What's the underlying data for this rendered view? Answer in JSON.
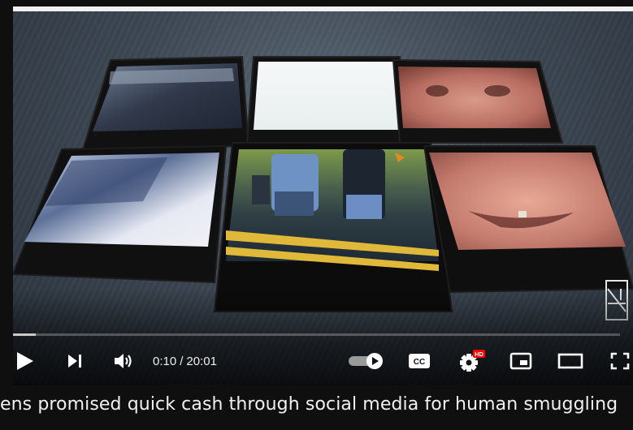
{
  "player": {
    "progress_fraction": 0.008,
    "time": {
      "current": "0:10",
      "separator": "/",
      "duration": "20:01"
    },
    "controls": {
      "play": "play-icon",
      "next": "next-icon",
      "volume": "volume-icon",
      "autoplay_toggle": "autoplay-toggle-icon",
      "captions_label": "CC",
      "settings": "gear-icon",
      "hd_badge": "HD",
      "miniplayer": "miniplayer-icon",
      "theater": "theater-icon",
      "fullscreen": "fullscreen-icon"
    },
    "accent_color": "#ff0000"
  },
  "video": {
    "title": "ens promised quick cash through social media for human smuggling"
  }
}
